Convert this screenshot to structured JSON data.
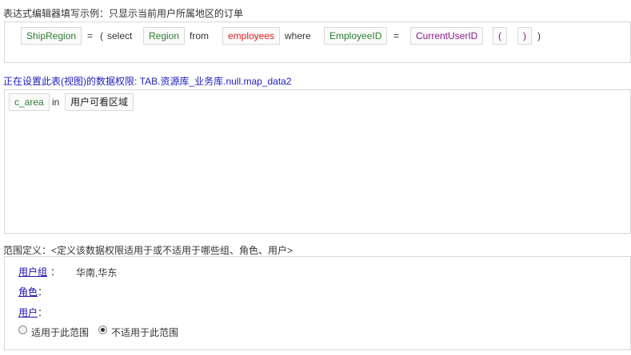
{
  "example": {
    "heading": "表达式编辑器填写示例：只显示当前用户所属地区的订单",
    "tokens": [
      "ShipRegion",
      "=",
      "(",
      "select",
      "Region",
      "from",
      "employees",
      "where",
      "EmployeeID",
      "=",
      "CurrentUserID",
      "(",
      ")",
      ")"
    ]
  },
  "permission": {
    "heading": "正在设置此表(视图)的数据权限: TAB.资源库_业务库.null.map_data2",
    "tokens": [
      "c_area",
      "in",
      "用户可看区域"
    ]
  },
  "scope": {
    "heading": "范围定义：<定义该数据权限适用于或不适用于哪些组、角色、用户>",
    "group_label": "用户组",
    "group_colon": "：",
    "group_value": "华南,华东",
    "role_label": "角色",
    "role_colon": "：",
    "user_label": "用户",
    "user_colon": "：",
    "apply_label": "适用于此范围",
    "not_apply_label": "不适用于此范围",
    "selected": "not_apply"
  },
  "colors": {
    "field": "#2e7d32",
    "table": "#e02020",
    "function": "#8b1a8b",
    "title": "#2020c0",
    "link": "#1a0dab"
  }
}
